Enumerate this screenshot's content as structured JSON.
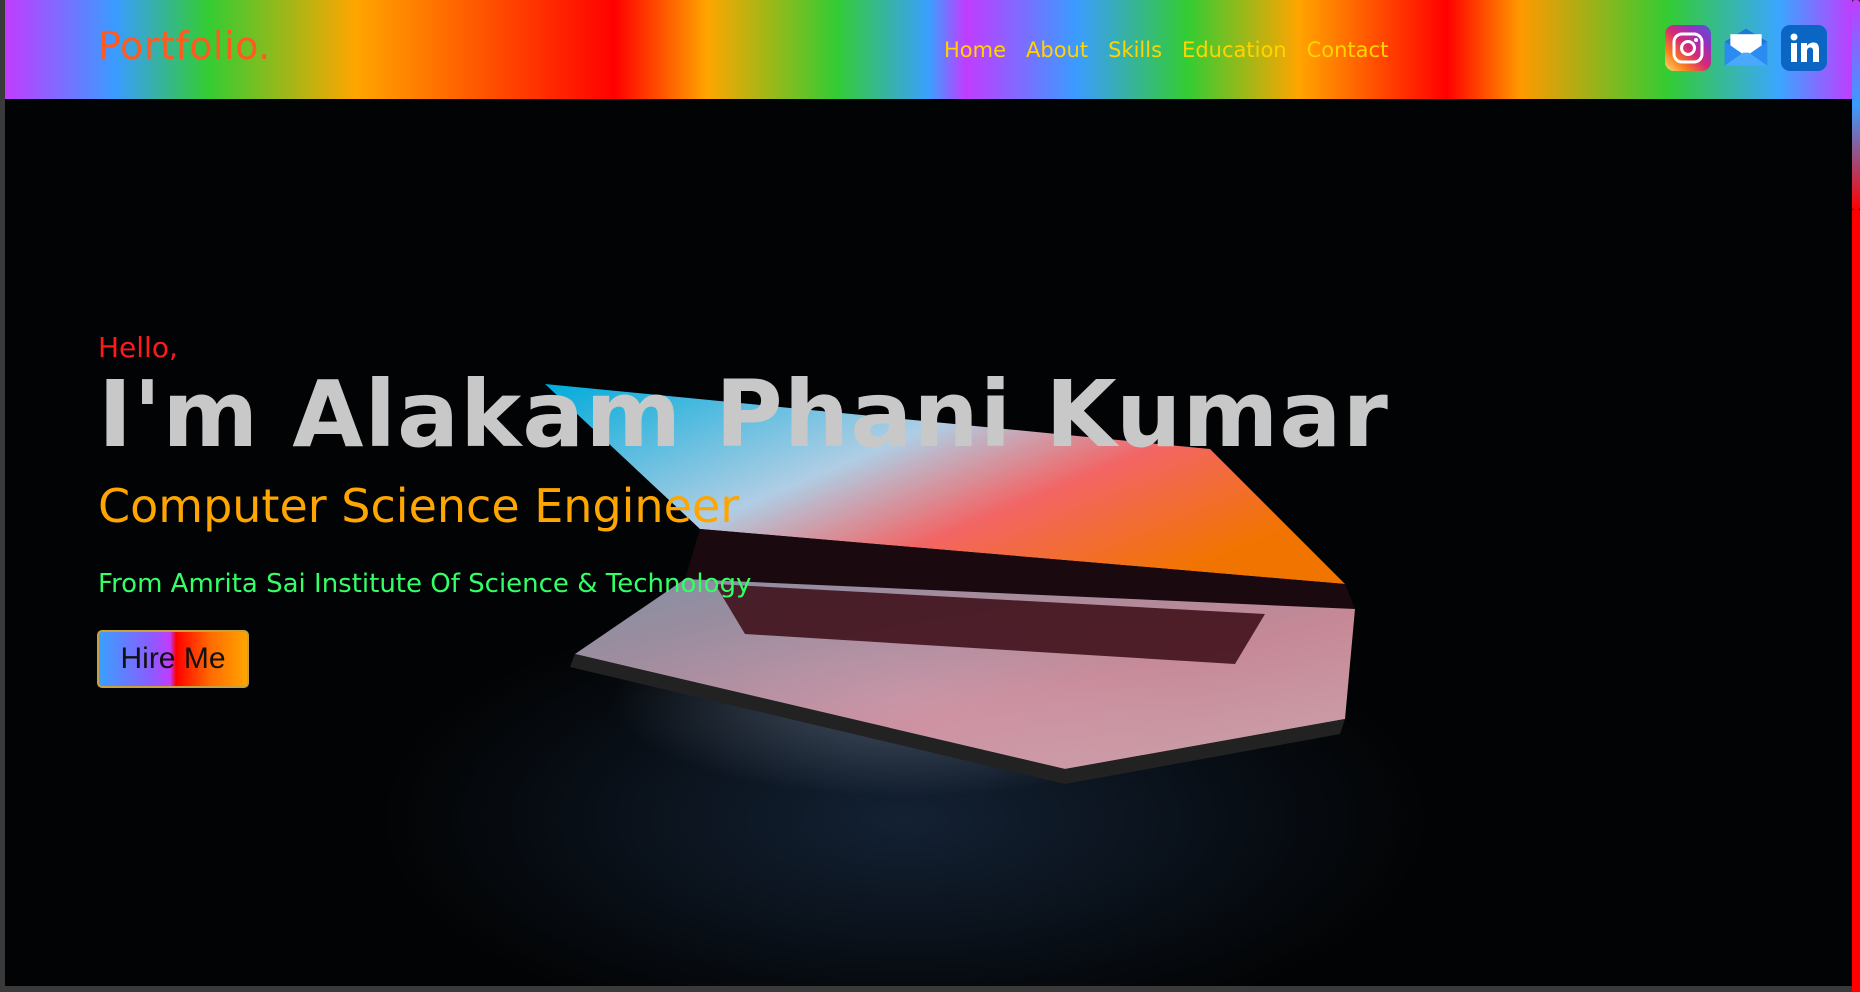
{
  "header": {
    "logo": "Portfolio.",
    "nav": [
      {
        "label": "Home"
      },
      {
        "label": "About"
      },
      {
        "label": "Skills"
      },
      {
        "label": "Education"
      },
      {
        "label": "Contact"
      }
    ],
    "social": [
      {
        "icon": "instagram-icon"
      },
      {
        "icon": "mail-icon"
      },
      {
        "icon": "linkedin-icon"
      }
    ]
  },
  "hero": {
    "greeting": "Hello,",
    "name": "I'm Alakam Phani Kumar",
    "role": "Computer Science Engineer",
    "school": "From Amrita Sai Institute Of Science & Technology",
    "cta_label": "Hire Me"
  },
  "colors": {
    "logo": "#ff5a1f",
    "nav": "#ffd400",
    "greeting": "#ff1a1a",
    "name": "#c8c8c8",
    "role": "#ffa500",
    "school": "#33ff66"
  }
}
